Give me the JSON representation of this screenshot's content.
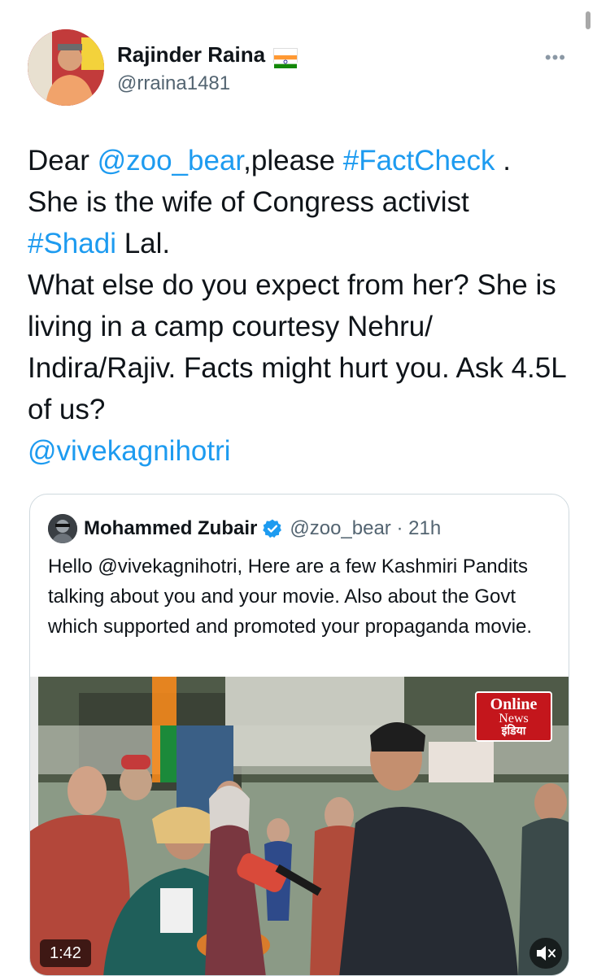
{
  "tweet": {
    "author_name": "Rajinder Raina",
    "author_handle": "@rraina1481",
    "more_label": "•••",
    "text": {
      "dear": "Dear ",
      "mention_zoo": "@zoo_bear",
      "please": ",please ",
      "hashtag_factcheck": "#FactCheck",
      "period": " .",
      "wife": "She is the wife of Congress activist",
      "hashtag_shadi": "#Shadi",
      "lal": " Lal.",
      "rest": "What else do you expect from her? She is living in a camp courtesy Nehru/ Indira/Rajiv. Facts might hurt you. Ask 4.5L of us?",
      "mention_vivek": "@vivekagnihotri"
    }
  },
  "quoted": {
    "author_name": "Mohammed Zubair",
    "author_handle": "@zoo_bear · 21h",
    "text": "Hello @vivekagnihotri, Here are a few Kashmiri Pandits talking about you and your movie. Also about the Govt which supported and promoted your propaganda movie.",
    "video": {
      "duration": "1:42",
      "logo_line1": "Online",
      "logo_line2": "News",
      "logo_line3": "इंडिया"
    }
  },
  "colors": {
    "link": "#1d9bf0",
    "verified": "#1d9bf0",
    "secondary_text": "#536471"
  }
}
